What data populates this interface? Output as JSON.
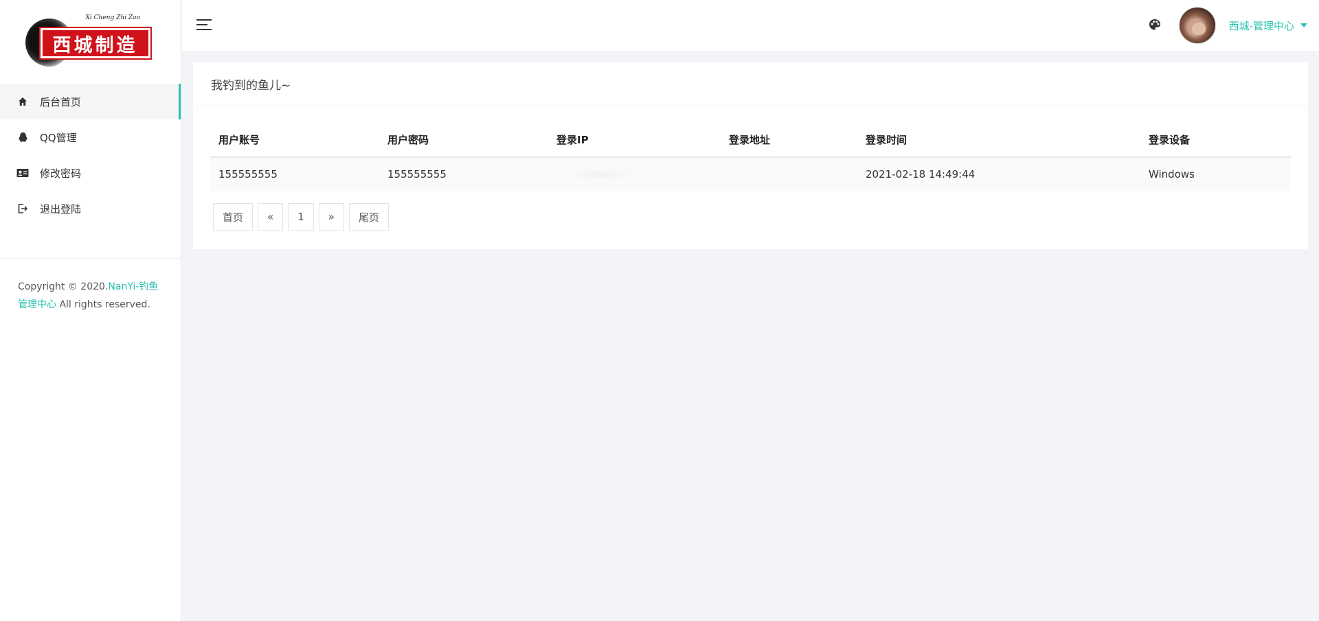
{
  "brand": {
    "logo_text": "西城制造",
    "logo_script": "Xi Cheng Zhi Zao"
  },
  "sidebar": {
    "items": [
      {
        "label": "后台首页",
        "icon": "home-icon",
        "active": true
      },
      {
        "label": "QQ管理",
        "icon": "qq-icon",
        "active": false
      },
      {
        "label": "修改密码",
        "icon": "id-card-icon",
        "active": false
      },
      {
        "label": "退出登陆",
        "icon": "logout-icon",
        "active": false
      }
    ],
    "copyright": {
      "prefix": "Copyright © 2020.",
      "link": "NanYi-钓鱼管理中心",
      "suffix": " All rights reserved."
    }
  },
  "header": {
    "user_name": "西城-管理中心"
  },
  "card": {
    "title": "我钓到的鱼儿~",
    "columns": [
      "用户账号",
      "用户密码",
      "登录IP",
      "登录地址",
      "登录时间",
      "登录设备"
    ],
    "rows": [
      {
        "account": "155555555",
        "password": "155555555",
        "ip": "",
        "location": "",
        "time": "2021-02-18 14:49:44",
        "device": "Windows"
      }
    ]
  },
  "pagination": {
    "first": "首页",
    "prev": "«",
    "current": "1",
    "next": "»",
    "last": "尾页"
  },
  "colors": {
    "accent": "#26c1b0",
    "background": "#f3f4f8",
    "logo_red": "#d0121b"
  }
}
